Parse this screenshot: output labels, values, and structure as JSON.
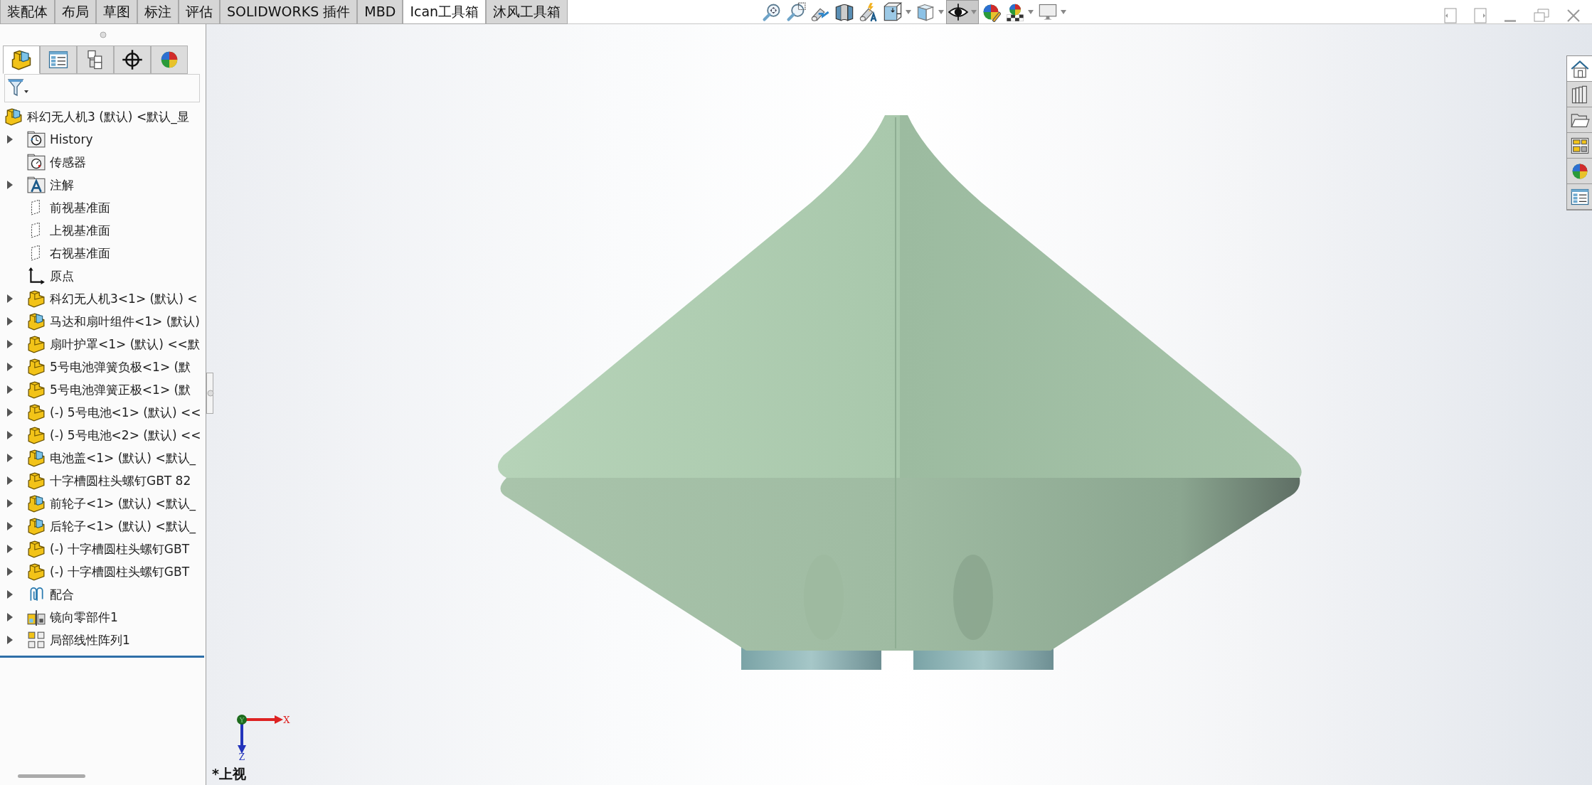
{
  "command_tabs": [
    {
      "label": "装配体",
      "selected": false
    },
    {
      "label": "布局",
      "selected": false
    },
    {
      "label": "草图",
      "selected": false
    },
    {
      "label": "标注",
      "selected": false
    },
    {
      "label": "评估",
      "selected": false
    },
    {
      "label": "SOLIDWORKS 插件",
      "selected": false
    },
    {
      "label": "MBD",
      "selected": false
    },
    {
      "label": "Ican工具箱",
      "selected": true
    },
    {
      "label": "沐风工具箱",
      "selected": false
    }
  ],
  "view_toolbar": [
    {
      "kind": "zoom-fit",
      "pressed": false,
      "has_menu": false
    },
    {
      "kind": "zoom-area",
      "pressed": false,
      "has_menu": false
    },
    {
      "kind": "previous-view",
      "pressed": false,
      "has_menu": false
    },
    {
      "kind": "section",
      "pressed": false,
      "has_menu": false
    },
    {
      "kind": "dynamic-annotation",
      "pressed": false,
      "has_menu": false
    },
    {
      "kind": "view-orientation",
      "pressed": false,
      "has_menu": true
    },
    {
      "kind": "display-style",
      "pressed": false,
      "has_menu": true
    },
    {
      "kind": "hide-show",
      "pressed": true,
      "has_menu": true
    },
    {
      "kind": "edit-appearance",
      "pressed": false,
      "has_menu": false
    },
    {
      "kind": "scene",
      "pressed": false,
      "has_menu": true
    },
    {
      "kind": "view-settings",
      "pressed": false,
      "has_menu": true
    }
  ],
  "panel_tabs": [
    {
      "kind": "feature-manager",
      "selected": true
    },
    {
      "kind": "property-manager",
      "selected": false
    },
    {
      "kind": "configuration-manager",
      "selected": false
    },
    {
      "kind": "dimxpert",
      "selected": false
    },
    {
      "kind": "display-manager",
      "selected": false
    }
  ],
  "tree": {
    "label": "科幻无人机3 (默认) <默认_显",
    "kind": "assembly",
    "children": [
      {
        "label": "History",
        "kind": "history",
        "expandable": true
      },
      {
        "label": "传感器",
        "kind": "sensor",
        "expandable": false
      },
      {
        "label": "注解",
        "kind": "annotation",
        "expandable": true
      },
      {
        "label": "前视基准面",
        "kind": "plane",
        "expandable": false
      },
      {
        "label": "上视基准面",
        "kind": "plane",
        "expandable": false
      },
      {
        "label": "右视基准面",
        "kind": "plane",
        "expandable": false
      },
      {
        "label": "原点",
        "kind": "origin",
        "expandable": false
      },
      {
        "label": "科幻无人机3<1> (默认) <",
        "kind": "part",
        "expandable": true
      },
      {
        "label": "马达和扇叶组件<1> (默认)",
        "kind": "assembly",
        "expandable": true
      },
      {
        "label": "扇叶护罩<1> (默认) <<默",
        "kind": "part",
        "expandable": true
      },
      {
        "label": "5号电池弹簧负极<1> (默",
        "kind": "part",
        "expandable": true
      },
      {
        "label": "5号电池弹簧正极<1> (默",
        "kind": "part",
        "expandable": true
      },
      {
        "label": "(-) 5号电池<1> (默认) <<",
        "kind": "part",
        "expandable": true
      },
      {
        "label": "(-) 5号电池<2> (默认) <<",
        "kind": "part",
        "expandable": true
      },
      {
        "label": "电池盖<1> (默认) <默认_",
        "kind": "assembly",
        "expandable": true
      },
      {
        "label": "十字槽圆柱头螺钉GBT 82",
        "kind": "part",
        "expandable": true
      },
      {
        "label": "前轮子<1> (默认) <默认_",
        "kind": "assembly",
        "expandable": true
      },
      {
        "label": "后轮子<1> (默认) <默认_",
        "kind": "assembly",
        "expandable": true
      },
      {
        "label": "(-) 十字槽圆柱头螺钉GBT",
        "kind": "part",
        "expandable": true
      },
      {
        "label": "(-) 十字槽圆柱头螺钉GBT",
        "kind": "part",
        "expandable": true
      },
      {
        "label": "配合",
        "kind": "mates",
        "expandable": true
      },
      {
        "label": "镜向零部件1",
        "kind": "mirror",
        "expandable": true
      },
      {
        "label": "局部线性阵列1",
        "kind": "pattern",
        "expandable": true
      }
    ]
  },
  "task_pane": [
    {
      "kind": "home",
      "selected": true
    },
    {
      "kind": "library",
      "selected": false
    },
    {
      "kind": "file-explorer",
      "selected": false
    },
    {
      "kind": "view-palette",
      "selected": false
    },
    {
      "kind": "appearances",
      "selected": false
    },
    {
      "kind": "custom-properties",
      "selected": false
    }
  ],
  "viewport": {
    "view_label": "*上视",
    "triad": {
      "x": "X",
      "y": "Y",
      "z": "Z"
    }
  }
}
